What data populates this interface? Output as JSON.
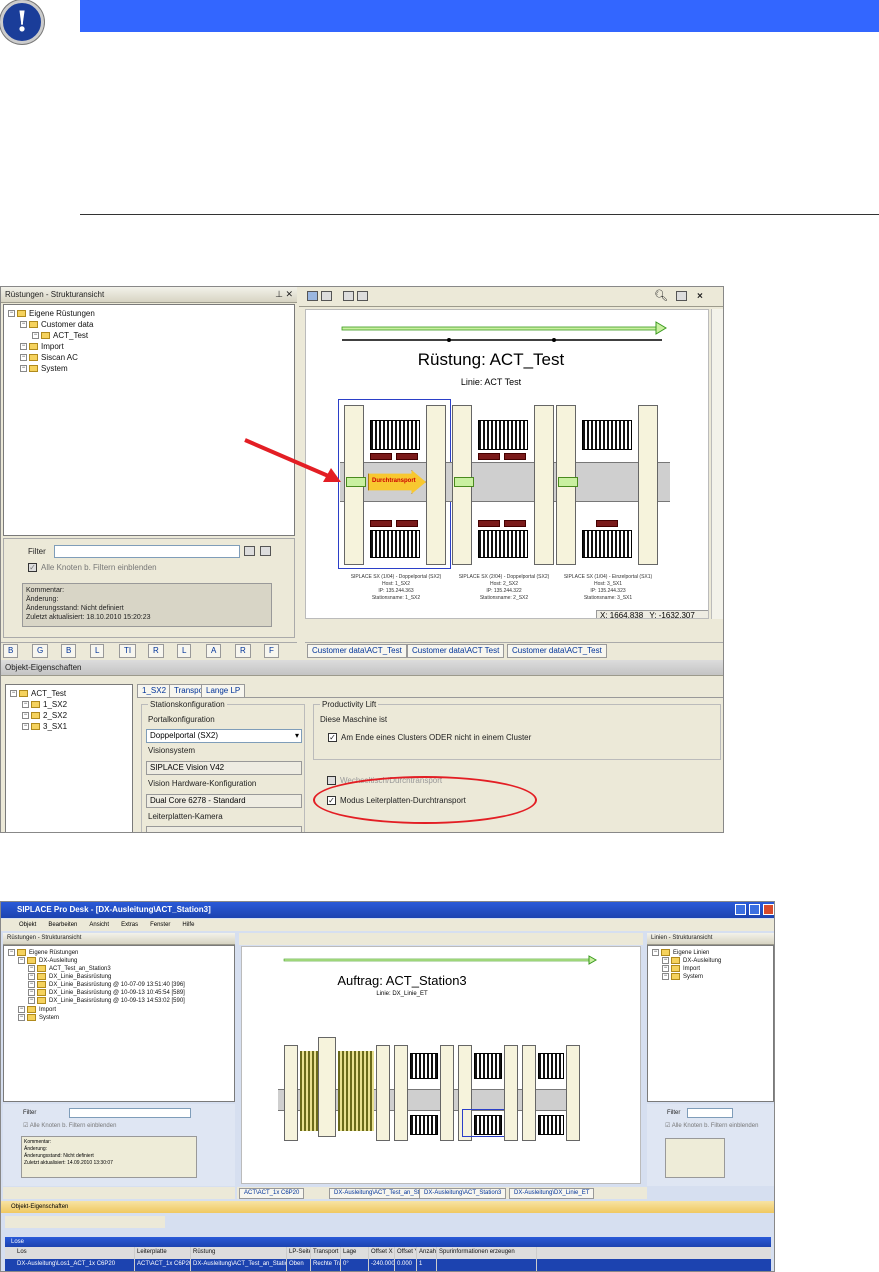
{
  "shot1": {
    "left_panel": {
      "title": "Rüstungen - Strukturansicht",
      "tree": [
        {
          "label": "Eigene Rüstungen",
          "indent": 0
        },
        {
          "label": "Customer data",
          "indent": 1
        },
        {
          "label": "ACT_Test",
          "indent": 2
        },
        {
          "label": "Import",
          "indent": 1
        },
        {
          "label": "Siscan AC",
          "indent": 1
        },
        {
          "label": "System",
          "indent": 1
        }
      ],
      "filter_label": "Filter",
      "show_all_label": "Alle Knoten b. Filtern einblenden",
      "info": [
        "Kommentar:",
        "Änderung:",
        "Änderungsstand: Nicht definiert",
        "Zuletzt aktualisiert: 18.10.2010 15:20:23"
      ]
    },
    "diagram": {
      "title": "Rüstung: ACT_Test",
      "line": "Linie: ACT Test",
      "durchtransport": "Durchtransport",
      "stations": [
        {
          "name": "SIPLACE SX (1/04) - Doppelportal (SX2)",
          "host": "Host: 1_SX2",
          "ip": "IP: 135.244.363",
          "station": "Stationsname: 1_SX2"
        },
        {
          "name": "SIPLACE SX (2/04) - Doppelportal (SX2)",
          "host": "Host: 2_SX2",
          "ip": "IP: 135.244.322",
          "station": "Stationsname: 2_SX2"
        },
        {
          "name": "SIPLACE SX (1/04) - Einzelportal (SX1)",
          "host": "Host: 3_SX1",
          "ip": "IP: 135.244.323",
          "station": "Stationsname: 3_SX1"
        }
      ],
      "coord_x_label": "X:",
      "coord_x": "1664.838",
      "coord_y_label": "Y:",
      "coord_y": "-1632.307"
    },
    "bottom_tabs": [
      "B",
      "G",
      "B",
      "L",
      "TI",
      "R",
      "L",
      "A",
      "R",
      "F"
    ],
    "doc_tabs": [
      "Customer data\\ACT_Test",
      "Customer data\\ACT Test",
      "Customer data\\ACT_Test"
    ],
    "props": {
      "title": "Objekt-Eigenschaften",
      "tree": [
        {
          "label": "ACT_Test",
          "indent": 0
        },
        {
          "label": "1_SX2",
          "indent": 1
        },
        {
          "label": "2_SX2",
          "indent": 1
        },
        {
          "label": "3_SX1",
          "indent": 1
        }
      ],
      "tabs": [
        "1_SX2",
        "Transport",
        "Lange LP"
      ],
      "station_group": "Stationskonfiguration",
      "portal_label": "Portalkonfiguration",
      "portal_value": "Doppelportal (SX2)",
      "vision_label": "Visionsystem",
      "vision_value": "SIPLACE Vision V42",
      "hw_label": "Vision Hardware-Konfiguration",
      "hw_value": "Dual Core 6278 - Standard",
      "cam_label": "Leiterplatten-Kamera",
      "productivity_group": "Productivity Lift",
      "machine_label": "Diese Maschine ist",
      "cluster_option": "Am Ende eines Clusters ODER nicht in einem Cluster",
      "hidden_option": "Wechseltisch/Durchtransport",
      "mode_option": "Modus Leiterplatten-Durchtransport"
    }
  },
  "shot2": {
    "title": "SIPLACE Pro Desk - [DX-Ausleitung\\ACT_Station3]",
    "menu": [
      "Objekt",
      "Bearbeiten",
      "Ansicht",
      "Extras",
      "Fenster",
      "Hilfe"
    ],
    "left_panel": {
      "title": "Rüstungen - Strukturansicht",
      "tree": [
        {
          "label": "Eigene Rüstungen",
          "indent": 0
        },
        {
          "label": "DX-Ausleitung",
          "indent": 1
        },
        {
          "label": "ACT_Test_an_Station3",
          "indent": 2
        },
        {
          "label": "DX_Linie_Basisrüstung",
          "indent": 2
        },
        {
          "label": "DX_Linie_Basisrüstung @ 10-07-09 13:51:40 [396]",
          "indent": 2
        },
        {
          "label": "DX_Linie_Basisrüstung @ 10-09-13 10:45:54 [589]",
          "indent": 2
        },
        {
          "label": "DX_Linie_Basisrüstung @ 10-09-13 14:53:02 [590]",
          "indent": 2
        },
        {
          "label": "Import",
          "indent": 1
        },
        {
          "label": "System",
          "indent": 1
        }
      ],
      "filter_label": "Filter",
      "show_all_label": "Alle Knoten b. Filtern einblenden",
      "info": [
        "Kommentar:",
        "Änderung:",
        "Änderungsstand: Nicht definiert",
        "Zuletzt aktualisiert: 14.09.2010 13:30:07"
      ]
    },
    "diagram": {
      "title": "Auftrag: ACT_Station3",
      "line": "Linie: DX_Linie_ET"
    },
    "right_panel": {
      "title": "Linien - Strukturansicht",
      "tree": [
        {
          "label": "Eigene Linien",
          "indent": 0
        },
        {
          "label": "DX-Ausleitung",
          "indent": 1
        },
        {
          "label": "Import",
          "indent": 1
        },
        {
          "label": "System",
          "indent": 1
        }
      ],
      "filter_label": "Filter",
      "show_all_label": "Alle Knoten b. Filtern einblenden"
    },
    "doc_tabs": [
      "ACT\\ACT_1x C6P20",
      "DX-Ausleitung\\ACT_Test_an_Station3",
      "DX-Ausleitung\\ACT_Station3",
      "DX-Ausleitung\\DX_Linie_ET"
    ],
    "props_title": "Objekt-Eigenschaften",
    "lose": {
      "title": "Lose",
      "columns": [
        "Los",
        "Leiterplatte",
        "Rüstung",
        "LP-Seite",
        "Transport",
        "Lage",
        "Offset X",
        "Offset Y",
        "Anzahl",
        "Spurinformationen erzeugen"
      ],
      "row": [
        "DX-Ausleitung\\Los1_ACT_1x C6P20",
        "ACT\\ACT_1x C6P20",
        "DX-Ausleitung\\ACT_Test_an_Station3",
        "Oben",
        "Rechte Tra",
        "0°",
        "-240.000",
        "0.000",
        "1",
        ""
      ]
    }
  },
  "colors": {
    "notice_bar": "#3366ff",
    "highlight_red": "#e31e24",
    "title_blue": "#1c43b0",
    "accent_green": "#3a9a1e"
  }
}
